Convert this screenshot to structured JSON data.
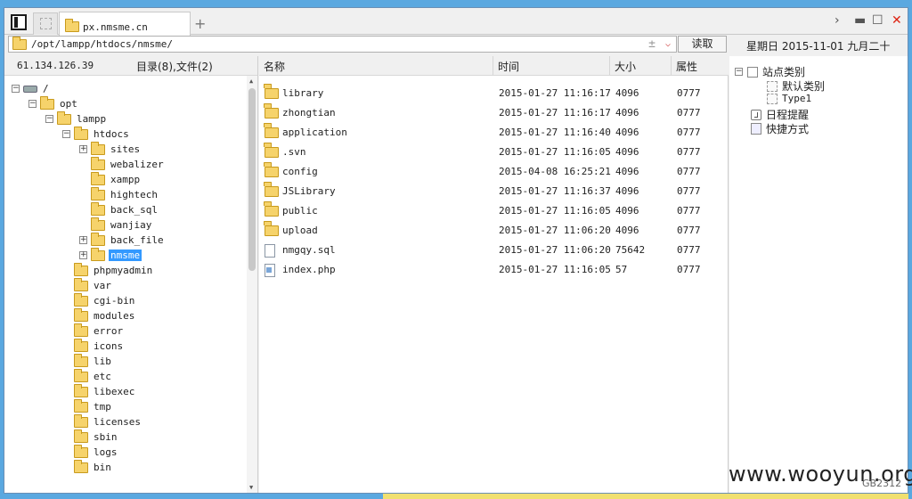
{
  "tabs": {
    "active_title": "px.nmsme.cn",
    "add": "+"
  },
  "window_controls": {
    "nav": "›",
    "minimize": "▬",
    "maximize": "☐",
    "close": "✕"
  },
  "address": {
    "path": "/opt/lampp/htdocs/nmsme/",
    "fav": "±",
    "dropdown": "⌵",
    "read_button": "读取"
  },
  "datetime": "星期日 2015-11-01 九月二十",
  "left": {
    "ip": "61.134.126.39",
    "summary": "目录(8),文件(2)",
    "tree": [
      {
        "label": "/",
        "toggle": "⊟"
      },
      {
        "label": "opt",
        "toggle": "⊟"
      },
      {
        "label": "lampp",
        "toggle": "⊟"
      },
      {
        "label": "htdocs",
        "toggle": "⊟"
      },
      {
        "label": "sites",
        "toggle": "⊞"
      },
      {
        "label": "webalizer",
        "toggle": ""
      },
      {
        "label": "xampp",
        "toggle": ""
      },
      {
        "label": "hightech",
        "toggle": ""
      },
      {
        "label": "back_sql",
        "toggle": ""
      },
      {
        "label": "wanjiay",
        "toggle": ""
      },
      {
        "label": "back_file",
        "toggle": "⊞"
      },
      {
        "label": "nmsme",
        "toggle": "⊞"
      },
      {
        "label": "phpmyadmin",
        "toggle": ""
      },
      {
        "label": "var",
        "toggle": ""
      },
      {
        "label": "cgi-bin",
        "toggle": ""
      },
      {
        "label": "modules",
        "toggle": ""
      },
      {
        "label": "error",
        "toggle": ""
      },
      {
        "label": "icons",
        "toggle": ""
      },
      {
        "label": "lib",
        "toggle": ""
      },
      {
        "label": "etc",
        "toggle": ""
      },
      {
        "label": "libexec",
        "toggle": ""
      },
      {
        "label": "tmp",
        "toggle": ""
      },
      {
        "label": "licenses",
        "toggle": ""
      },
      {
        "label": "sbin",
        "toggle": ""
      },
      {
        "label": "logs",
        "toggle": ""
      },
      {
        "label": "bin",
        "toggle": ""
      }
    ]
  },
  "columns": {
    "name": "名称",
    "time": "时间",
    "size": "大小",
    "attr": "属性"
  },
  "files": [
    {
      "name": "library",
      "time": "2015-01-27 11:16:17",
      "size": "4096",
      "attr": "0777",
      "type": "folder"
    },
    {
      "name": "zhongtian",
      "time": "2015-01-27 11:16:17",
      "size": "4096",
      "attr": "0777",
      "type": "folder"
    },
    {
      "name": "application",
      "time": "2015-01-27 11:16:40",
      "size": "4096",
      "attr": "0777",
      "type": "folder"
    },
    {
      "name": ".svn",
      "time": "2015-01-27 11:16:05",
      "size": "4096",
      "attr": "0777",
      "type": "folder"
    },
    {
      "name": "config",
      "time": "2015-04-08 16:25:21",
      "size": "4096",
      "attr": "0777",
      "type": "folder"
    },
    {
      "name": "JSLibrary",
      "time": "2015-01-27 11:16:37",
      "size": "4096",
      "attr": "0777",
      "type": "folder"
    },
    {
      "name": "public",
      "time": "2015-01-27 11:16:05",
      "size": "4096",
      "attr": "0777",
      "type": "folder"
    },
    {
      "name": "upload",
      "time": "2015-01-27 11:06:20",
      "size": "4096",
      "attr": "0777",
      "type": "folder"
    },
    {
      "name": "nmgqy.sql",
      "time": "2015-01-27 11:06:20",
      "size": "75642",
      "attr": "0777",
      "type": "file"
    },
    {
      "name": "index.php",
      "time": "2015-01-27 11:16:05",
      "size": "57",
      "attr": "0777",
      "type": "php"
    }
  ],
  "right": {
    "site_category": "站点类别",
    "default_category": "默认类别",
    "type1": "Type1",
    "schedule": "日程提醒",
    "shortcut": "快捷方式"
  },
  "watermark": {
    "text": "www.wooyun.org",
    "code": "GB2312"
  }
}
